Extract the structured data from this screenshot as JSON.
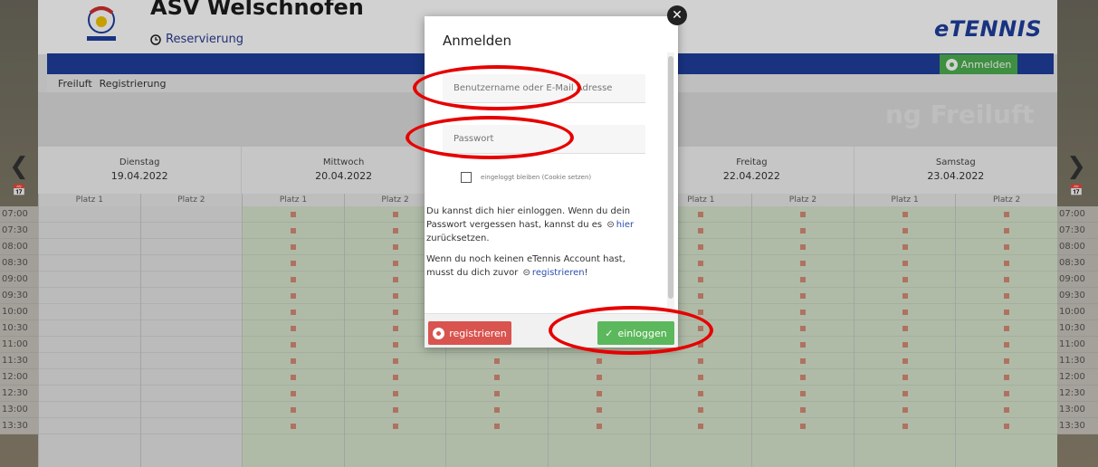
{
  "header": {
    "club_name": "ASV Welschnofen",
    "reservation_label": "Reservierung",
    "brand": "eTENNIS",
    "login_button": "Anmelden"
  },
  "nav": {
    "items": [
      "Freiluft",
      "Registrierung"
    ]
  },
  "watermark": "ng Freiluft",
  "days": [
    {
      "name": "Dienstag",
      "date": "19.04.2022"
    },
    {
      "name": "Mittwoch",
      "date": "20.04.2022"
    },
    {
      "name": "",
      "date": ""
    },
    {
      "name": "Freitag",
      "date": "22.04.2022"
    },
    {
      "name": "Samstag",
      "date": "23.04.2022"
    }
  ],
  "courts": [
    "Platz 1",
    "Platz 2",
    "Platz 1",
    "Platz 2",
    "",
    "",
    "Platz 1",
    "Platz 2",
    "Platz 1",
    "Platz 2"
  ],
  "times": [
    "07:00",
    "07:30",
    "08:00",
    "08:30",
    "09:00",
    "09:30",
    "10:00",
    "10:30",
    "11:00",
    "11:30",
    "12:00",
    "12:30",
    "13:00",
    "13:30"
  ],
  "modal": {
    "title": "Anmelden",
    "username_placeholder": "Benutzername oder E-Mail Adresse",
    "password_placeholder": "Passwort",
    "remember_label": "eingeloggt bleiben (Cookie setzen)",
    "help1_pre": "Du kannst dich hier einloggen. Wenn du dein Passwort vergessen hast, kannst du es",
    "help1_link": "hier",
    "help1_post": "zurücksetzen.",
    "help2_pre": "Wenn du noch keinen eTennis Account hast, musst du dich zuvor",
    "help2_link": "registrieren",
    "help2_post": "!",
    "register_button": "registrieren",
    "login_button": "einloggen"
  },
  "colors": {
    "brand_blue": "#1f3f9e",
    "login_green": "#5cb85c",
    "register_red": "#d9534f",
    "annotation_red": "#e60000"
  }
}
